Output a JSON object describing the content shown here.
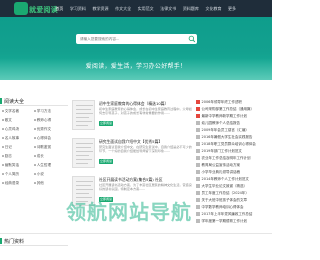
{
  "brand": {
    "name": "就爱阅读"
  },
  "nav": [
    "首页",
    "学习资料",
    "教学资源",
    "作文大全",
    "实用范文",
    "法律文书",
    "资料题库",
    "文化教育",
    "更多"
  ],
  "search": {
    "placeholder": "请输入您要搜索的内容..."
  },
  "hero": {
    "slogan": "爱阅读，爱生活，学习办公好帮手！"
  },
  "reading_nav": {
    "title": "阅读大全",
    "categories": [
      "文学名著",
      "学习方法",
      "散文",
      "教师心得",
      "心灵鸡汤",
      "优秀作文",
      "名人故事",
      "心得体会",
      "日记",
      "诗歌鉴赏",
      "励志",
      "成长",
      "幽默笑话",
      "人生哲理",
      "个人简历",
      "小说",
      "经典语录",
      "其他"
    ]
  },
  "articles": [
    {
      "title": "初中生家庭教育的心得体会（精选10篇）",
      "desc": "初中生家庭教育的心得体会，成长在初中生家庭教育过程中，父母如何去引导孩子，对孩子的成长有非常重要的作用……",
      "button": "立即阅读"
    },
    {
      "title": "研究生面试自我介绍中文【优秀5篇】",
      "desc": "研究生面试自我介绍中文，在研究生复试中，自我介绍是必不可少的环节，一个好的自我介绍能给导师留下深刻印象……",
      "button": "立即阅读"
    },
    {
      "title": "社区开展读书活动方案(集合5篇) 社区",
      "desc": "社区开展读书活动方案，为了丰富社区居民的精神文化生活，营造良好的读书氛围，特制定本方案……",
      "button": "立即阅读"
    }
  ],
  "ranking": [
    "2006年领导年终工作述职",
    "公司采购部第工作总结（通用篇）",
    "最新中学教师新学期工作计划",
    "幼儿园教师个人总结报告",
    "2009年年会员工感言（汇编）",
    "2016年暑假大学生社会实践报告",
    "2018年职工党员群众培训心得体会",
    "2019年部门工作计划范文",
    "农业年工作总结及明年工作计划",
    "教育局公益宣传活动方案",
    "小学毕业典礼领导讲话稿",
    "2014年教师个人工作计划范文",
    "大学生毕业论文致谢（精选）",
    "员工年度工作总结（2024年）",
    "关于大班中班孩子体会的文章",
    "中学数学教师培训心得体会",
    "2017年上半年党风廉政工作总结",
    "学年度第一学期德育工作计划"
  ],
  "hot": {
    "title": "热门资料"
  },
  "watermark": {
    "text": "领航网站导航"
  },
  "colors": {
    "accent": "#1aa971",
    "topbar": "#1f2d3a",
    "hero": "#13a18f"
  }
}
